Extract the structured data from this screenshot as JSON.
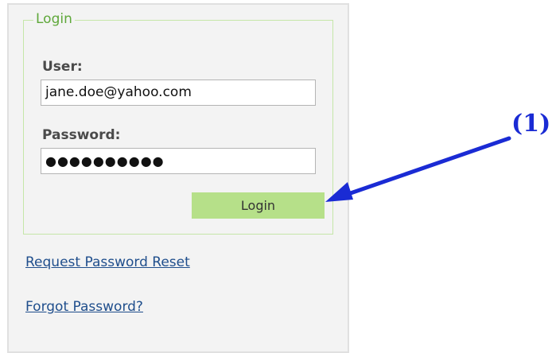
{
  "login_panel": {
    "legend": "Login",
    "user_label": "User:",
    "user_value": "jane.doe@yahoo.com",
    "password_label": "Password:",
    "password_mask": "●●●●●●●●●●",
    "login_button": "Login"
  },
  "links": {
    "request_reset": "Request Password Reset",
    "forgot_password": "Forgot Password?"
  },
  "annotation": {
    "label": "(1)",
    "color": "#1a2bd4"
  }
}
